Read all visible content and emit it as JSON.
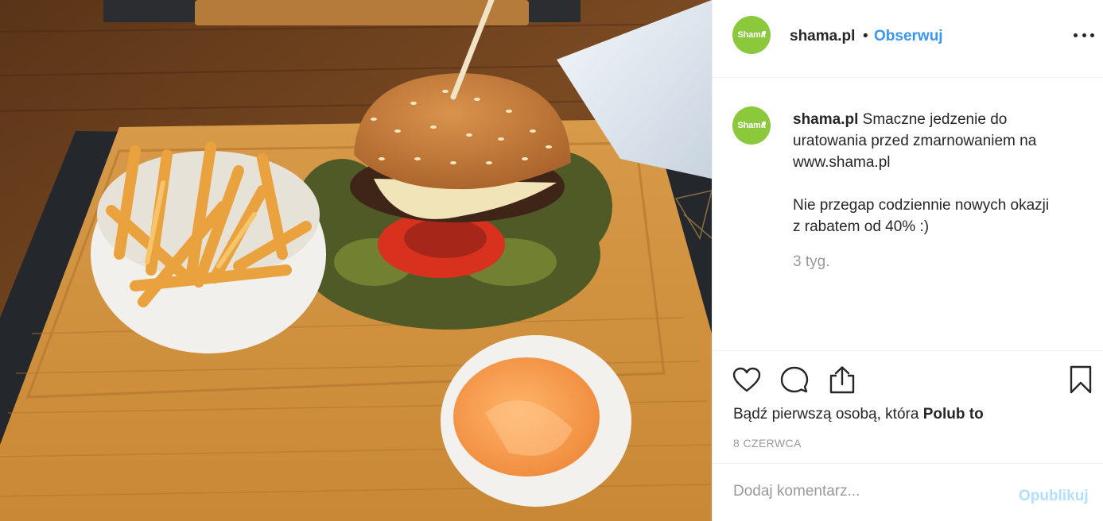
{
  "post": {
    "username": "shama.pl",
    "avatar_text": "Shama",
    "separator": "•",
    "follow_label": "Obserwuj",
    "accent_color": "#3897f0",
    "avatar_color": "#8cc83c"
  },
  "caption": {
    "username": "shama.pl",
    "line1": "Smaczne jedzenie do",
    "line2": "uratowania przed zmarnowaniem na",
    "line3": "www.shama.pl",
    "line4": "Nie przegap codziennie nowych okazji",
    "line5": "z rabatem od 40% :)",
    "time": "3 tyg."
  },
  "actions": {
    "icons": [
      "heart-icon",
      "comment-icon",
      "share-icon",
      "bookmark-icon"
    ],
    "likes_prefix": "Bądź pierwszą osobą, która",
    "likes_link": "Polub to",
    "date": "8 CZERWCA"
  },
  "comment": {
    "placeholder": "Dodaj komentarz...",
    "publish_label": "Opublikuj"
  }
}
